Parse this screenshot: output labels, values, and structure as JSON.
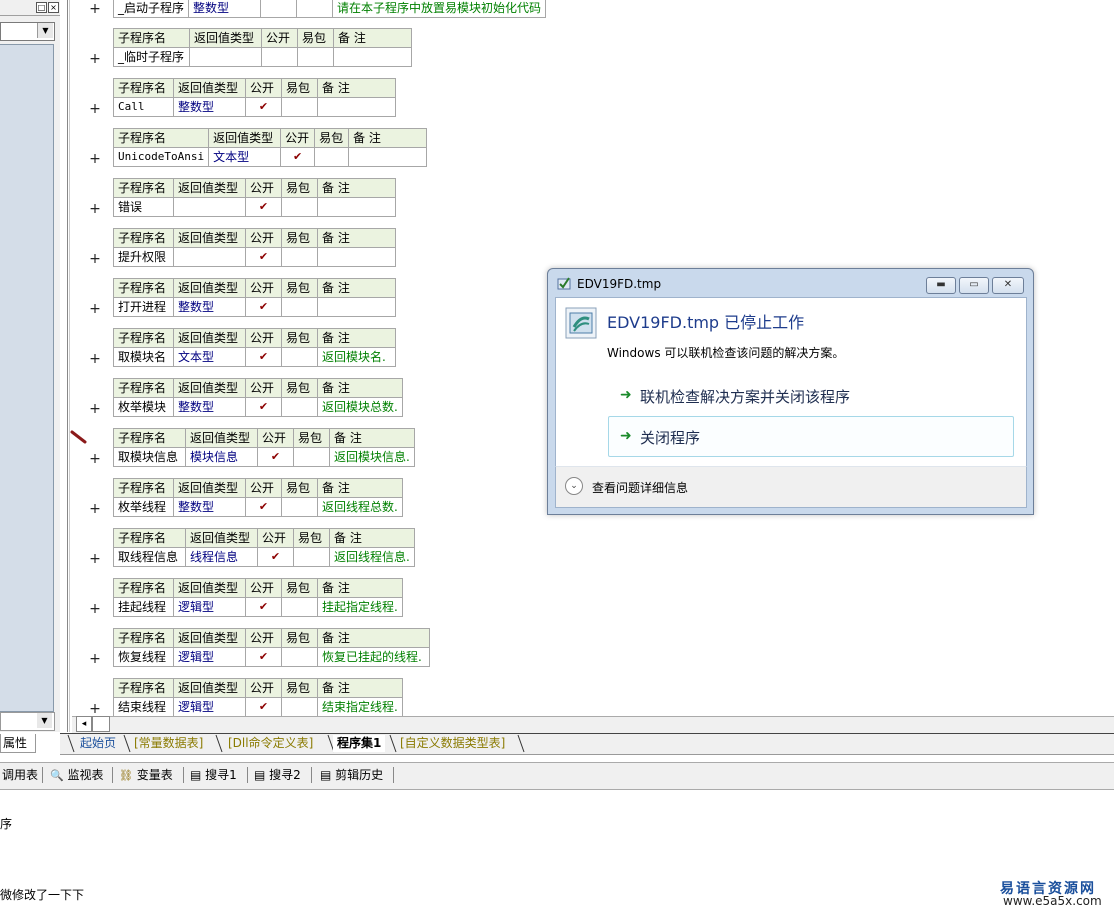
{
  "left_panel": {
    "title_buttons": [
      "□",
      "×"
    ],
    "combo_arrow": "▼",
    "scroll_arrow": "▼",
    "properties_tab": "属性"
  },
  "subprograms": [
    {
      "headers": null,
      "name": "_启动子程序",
      "return_type": "整数型",
      "public": "",
      "easy": "",
      "note": "请在本子程序中放置易模块初始化代码",
      "mono": false
    },
    {
      "headers": [
        "子程序名",
        "返回值类型",
        "公开",
        "易包",
        "备 注"
      ],
      "name": "_临时子程序",
      "return_type": "",
      "public": "",
      "easy": "",
      "note": "",
      "mono": false
    },
    {
      "headers": [
        "子程序名",
        "返回值类型",
        "公开",
        "易包",
        "备 注"
      ],
      "name": "Call",
      "return_type": "整数型",
      "public": "✔",
      "easy": "",
      "note": "",
      "mono": true
    },
    {
      "headers": [
        "子程序名",
        "返回值类型",
        "公开",
        "易包",
        "备 注"
      ],
      "name": "UnicodeToAnsi",
      "return_type": "文本型",
      "public": "✔",
      "easy": "",
      "note": "",
      "mono": true
    },
    {
      "headers": [
        "子程序名",
        "返回值类型",
        "公开",
        "易包",
        "备 注"
      ],
      "name": "错误",
      "return_type": "",
      "public": "✔",
      "easy": "",
      "note": "",
      "mono": false
    },
    {
      "headers": [
        "子程序名",
        "返回值类型",
        "公开",
        "易包",
        "备 注"
      ],
      "name": "提升权限",
      "return_type": "",
      "public": "✔",
      "easy": "",
      "note": "",
      "mono": false
    },
    {
      "headers": [
        "子程序名",
        "返回值类型",
        "公开",
        "易包",
        "备 注"
      ],
      "name": "打开进程",
      "return_type": "整数型",
      "public": "✔",
      "easy": "",
      "note": "",
      "mono": false
    },
    {
      "headers": [
        "子程序名",
        "返回值类型",
        "公开",
        "易包",
        "备 注"
      ],
      "name": "取模块名",
      "return_type": "文本型",
      "public": "✔",
      "easy": "",
      "note": "返回模块名.",
      "mono": false
    },
    {
      "headers": [
        "子程序名",
        "返回值类型",
        "公开",
        "易包",
        "备 注"
      ],
      "name": "枚举模块",
      "return_type": "整数型",
      "public": "✔",
      "easy": "",
      "note": "返回模块总数.",
      "mono": false
    },
    {
      "headers": [
        "子程序名",
        "返回值类型",
        "公开",
        "易包",
        "备 注"
      ],
      "name": "取模块信息",
      "return_type": "模块信息",
      "public": "✔",
      "easy": "",
      "note": "返回模块信息.",
      "mono": false
    },
    {
      "headers": [
        "子程序名",
        "返回值类型",
        "公开",
        "易包",
        "备 注"
      ],
      "name": "枚举线程",
      "return_type": "整数型",
      "public": "✔",
      "easy": "",
      "note": "返回线程总数.",
      "mono": false
    },
    {
      "headers": [
        "子程序名",
        "返回值类型",
        "公开",
        "易包",
        "备 注"
      ],
      "name": "取线程信息",
      "return_type": "线程信息",
      "public": "✔",
      "easy": "",
      "note": "返回线程信息.",
      "mono": false
    },
    {
      "headers": [
        "子程序名",
        "返回值类型",
        "公开",
        "易包",
        "备 注"
      ],
      "name": "挂起线程",
      "return_type": "逻辑型",
      "public": "✔",
      "easy": "",
      "note": "挂起指定线程.",
      "mono": false
    },
    {
      "headers": [
        "子程序名",
        "返回值类型",
        "公开",
        "易包",
        "备 注"
      ],
      "name": "恢复线程",
      "return_type": "逻辑型",
      "public": "✔",
      "easy": "",
      "note": "恢复已挂起的线程.",
      "mono": false
    },
    {
      "headers": [
        "子程序名",
        "返回值类型",
        "公开",
        "易包",
        "备 注"
      ],
      "name": "结束线程",
      "return_type": "逻辑型",
      "public": "✔",
      "easy": "",
      "note": "结束指定线程.",
      "mono": false
    }
  ],
  "plus_symbol": "+",
  "tabs": [
    {
      "label": "起始页",
      "color": "#1a4f9c",
      "bold": false
    },
    {
      "label": "[常量数据表]",
      "color": "#8a7a00",
      "bold": false
    },
    {
      "label": "[Dll命令定义表]",
      "color": "#8a7a00",
      "bold": false
    },
    {
      "label": "程序集1",
      "color": "#000000",
      "bold": true
    },
    {
      "label": "[自定义数据类型表]",
      "color": "#8a7a00",
      "bold": false
    }
  ],
  "bottom_toolbar": [
    {
      "label": "调用表",
      "icon": ""
    },
    {
      "label": "监视表",
      "icon": "🔍"
    },
    {
      "label": "变量表",
      "icon": "⛓"
    },
    {
      "label": "搜寻1",
      "icon": "▤"
    },
    {
      "label": "搜寻2",
      "icon": "▤"
    },
    {
      "label": "剪辑历史",
      "icon": "▤"
    }
  ],
  "output": {
    "line1": "序",
    "line2": "微修改了一下下"
  },
  "watermark": {
    "title": "易语言资源网",
    "url": "www.e5a5x.com"
  },
  "dialog": {
    "title": "EDV19FD.tmp",
    "heading": "EDV19FD.tmp 已停止工作",
    "description": "Windows 可以联机检查该问题的解决方案。",
    "option1": "联机检查解决方案并关闭该程序",
    "option2": "关闭程序",
    "details": "查看问题详细信息",
    "min_glyph": "▬",
    "max_glyph": "▭",
    "close_glyph": "✕",
    "arrow_glyph": "➜",
    "expand_glyph": "⌄"
  }
}
